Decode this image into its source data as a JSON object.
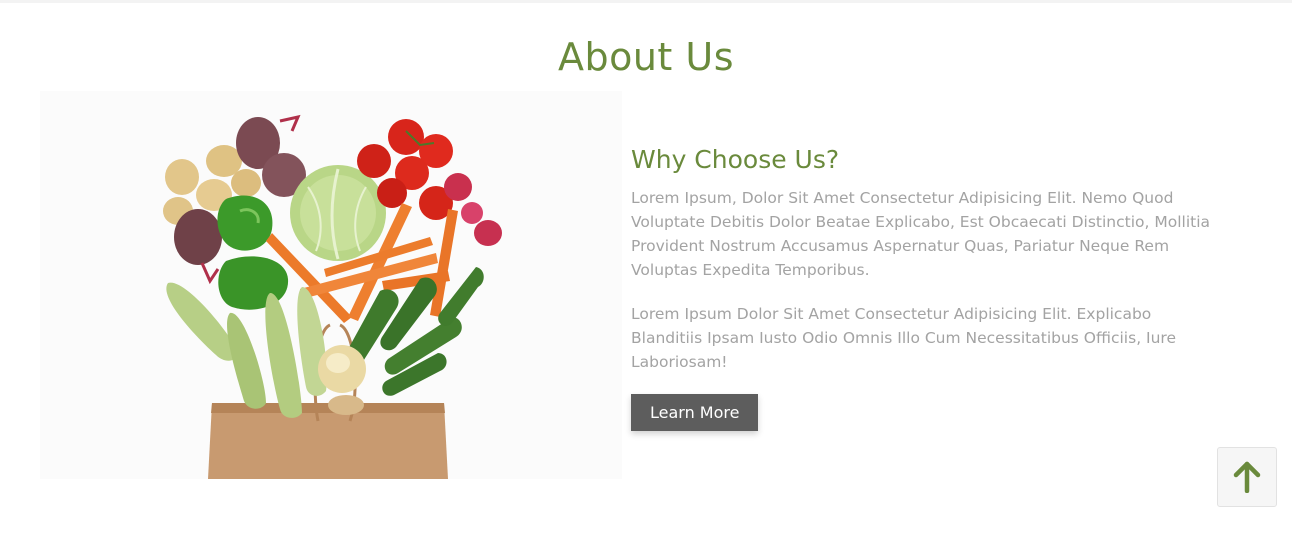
{
  "about": {
    "title": "About Us",
    "heading": "Why Choose Us?",
    "paragraph_1": "Lorem Ipsum, Dolor Sit Amet Consectetur Adipisicing Elit. Nemo Quod Voluptate Debitis Dolor Beatae Explicabo, Est Obcaecati Distinctio, Mollitia Provident Nostrum Accusamus Aspernatur Quas, Pariatur Neque Rem Voluptas Expedita Temporibus.",
    "paragraph_2": "Lorem Ipsum Dolor Sit Amet Consectetur Adipisicing Elit. Explicabo Blanditiis Ipsam Iusto Odio Omnis Illo Cum Necessitatibus Officiis, Iure Laboriosam!",
    "button_label": "Learn More"
  },
  "icons": {
    "scroll_top": "arrow-up-icon"
  },
  "colors": {
    "accent": "#6a8a3c",
    "text_muted": "#a3a3a3",
    "button_bg": "#5d5d5d"
  }
}
